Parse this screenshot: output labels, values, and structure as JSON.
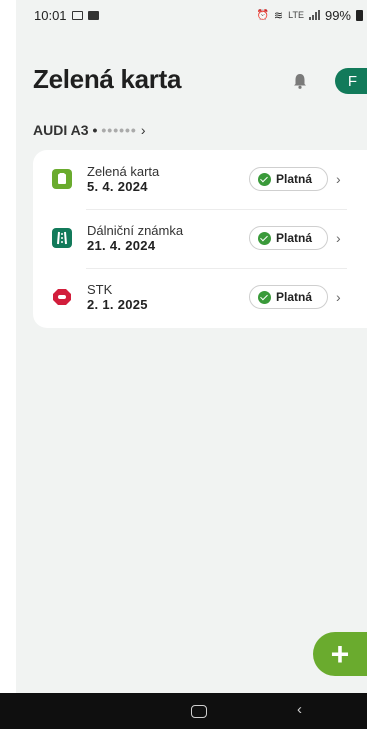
{
  "status_bar": {
    "time": "10:01",
    "battery": "99%",
    "network": "LTE"
  },
  "header": {
    "title": "Zelená karta",
    "avatar_initial": "F"
  },
  "vehicle": {
    "name": "AUDI A3",
    "separator": "•",
    "plate": "••••••"
  },
  "items": [
    {
      "label": "Zelená karta",
      "date": "5. 4. 2024",
      "status": "Platná",
      "icon": "green-card-icon",
      "color": "#6aab2e"
    },
    {
      "label": "Dálniční známka",
      "date": "21. 4. 2024",
      "status": "Platná",
      "icon": "highway-icon",
      "color": "#127a5a"
    },
    {
      "label": "STK",
      "date": "2. 1. 2025",
      "status": "Platná",
      "icon": "stk-icon",
      "color": "#d21e3c"
    }
  ],
  "fab": {
    "label": "+"
  },
  "colors": {
    "accent": "#6aab2e",
    "brand": "#127a5a",
    "background": "#f1f3f2"
  }
}
